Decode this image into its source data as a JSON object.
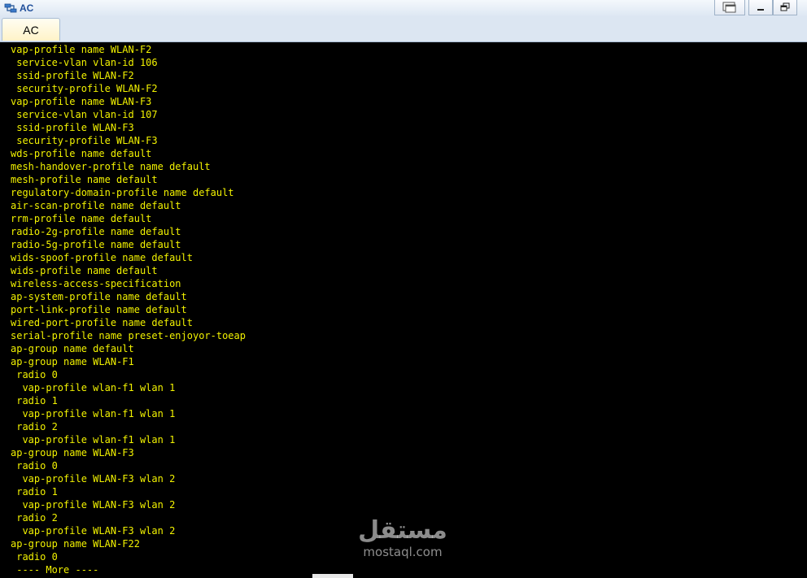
{
  "window": {
    "title": "AC",
    "icon": "network-device-icon",
    "controls": [
      "restore-icon",
      "minimize-icon",
      "maximize-icon"
    ]
  },
  "tabs": [
    {
      "label": "AC",
      "active": true
    }
  ],
  "terminal": {
    "text_color": "#f2f200",
    "background": "#000000",
    "lines": [
      "vap-profile name WLAN-F2",
      " service-vlan vlan-id 106",
      " ssid-profile WLAN-F2",
      " security-profile WLAN-F2",
      "vap-profile name WLAN-F3",
      " service-vlan vlan-id 107",
      " ssid-profile WLAN-F3",
      " security-profile WLAN-F3",
      "wds-profile name default",
      "mesh-handover-profile name default",
      "mesh-profile name default",
      "regulatory-domain-profile name default",
      "air-scan-profile name default",
      "rrm-profile name default",
      "radio-2g-profile name default",
      "radio-5g-profile name default",
      "wids-spoof-profile name default",
      "wids-profile name default",
      "wireless-access-specification",
      "ap-system-profile name default",
      "port-link-profile name default",
      "wired-port-profile name default",
      "serial-profile name preset-enjoyor-toeap",
      "ap-group name default",
      "ap-group name WLAN-F1",
      " radio 0",
      "  vap-profile wlan-f1 wlan 1",
      " radio 1",
      "  vap-profile wlan-f1 wlan 1",
      " radio 2",
      "  vap-profile wlan-f1 wlan 1",
      "ap-group name WLAN-F3",
      " radio 0",
      "  vap-profile WLAN-F3 wlan 2",
      " radio 1",
      "  vap-profile WLAN-F3 wlan 2",
      " radio 2",
      "  vap-profile WLAN-F3 wlan 2",
      "ap-group name WLAN-F22",
      " radio 0",
      " ---- More ----"
    ]
  },
  "watermark": {
    "arabic": "مستقل",
    "latin": "mostaql.com"
  }
}
